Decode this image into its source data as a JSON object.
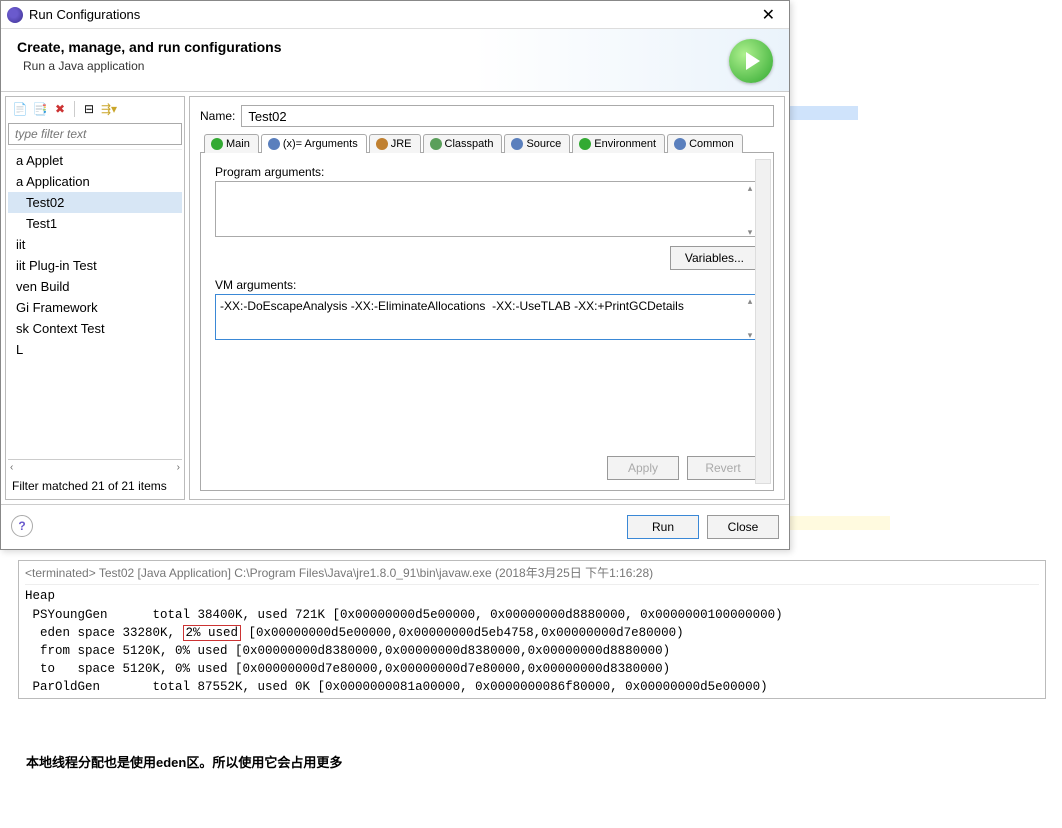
{
  "window": {
    "title": "Run Configurations",
    "close_glyph": "✕"
  },
  "header": {
    "title": "Create, manage, and run configurations",
    "subtitle": "Run a Java application"
  },
  "sidebar": {
    "filter_placeholder": "type filter text",
    "items": [
      {
        "label": "a Applet",
        "indent": false,
        "selected": false
      },
      {
        "label": "a Application",
        "indent": false,
        "selected": false
      },
      {
        "label": "Test02",
        "indent": true,
        "selected": true
      },
      {
        "label": "Test1",
        "indent": true,
        "selected": false
      },
      {
        "label": "iit",
        "indent": false,
        "selected": false
      },
      {
        "label": "iit Plug-in Test",
        "indent": false,
        "selected": false
      },
      {
        "label": "ven Build",
        "indent": false,
        "selected": false
      },
      {
        "label": "Gi Framework",
        "indent": false,
        "selected": false
      },
      {
        "label": "sk Context Test",
        "indent": false,
        "selected": false
      },
      {
        "label": "L",
        "indent": false,
        "selected": false
      }
    ],
    "filter_status": "Filter matched 21 of 21 items"
  },
  "main": {
    "name_label": "Name:",
    "name_value": "Test02",
    "tabs": [
      {
        "label": "Main",
        "active": false,
        "icon_color": "#33aa33"
      },
      {
        "label": "(x)= Arguments",
        "active": true,
        "icon_color": "#5a7fbd"
      },
      {
        "label": "JRE",
        "active": false,
        "icon_color": "#c08030"
      },
      {
        "label": "Classpath",
        "active": false,
        "icon_color": "#5a9f5a"
      },
      {
        "label": "Source",
        "active": false,
        "icon_color": "#5a7fbd"
      },
      {
        "label": "Environment",
        "active": false,
        "icon_color": "#33aa33"
      },
      {
        "label": "Common",
        "active": false,
        "icon_color": "#5a7fbd"
      }
    ],
    "program_args_label": "Program arguments:",
    "program_args_value": "",
    "variables_button": "Variables...",
    "vm_args_label": "VM arguments:",
    "vm_args_value": "-XX:-DoEscapeAnalysis -XX:-EliminateAllocations  -XX:-UseTLAB -XX:+PrintGCDetails",
    "apply_button": "Apply",
    "revert_button": "Revert"
  },
  "footer": {
    "help_glyph": "?",
    "run_button": "Run",
    "close_button": "Close"
  },
  "console": {
    "header": "<terminated> Test02 [Java Application] C:\\Program Files\\Java\\jre1.8.0_91\\bin\\javaw.exe (2018年3月25日 下午1:16:28)",
    "lines": [
      "Heap",
      " PSYoungGen      total 38400K, used 721K [0x00000000d5e00000, 0x00000000d8880000, 0x0000000100000000)",
      "  eden space 33280K, |2% used| [0x00000000d5e00000,0x00000000d5eb4758,0x00000000d7e80000)",
      "  from space 5120K, 0% used [0x00000000d8380000,0x00000000d8380000,0x00000000d8880000)",
      "  to   space 5120K, 0% used [0x00000000d7e80000,0x00000000d7e80000,0x00000000d8380000)",
      " ParOldGen       total 87552K, used 0K [0x0000000081a00000, 0x0000000086f80000, 0x00000000d5e00000)"
    ]
  },
  "note_text": "本地线程分配也是使用eden区。所以使用它会占用更多"
}
